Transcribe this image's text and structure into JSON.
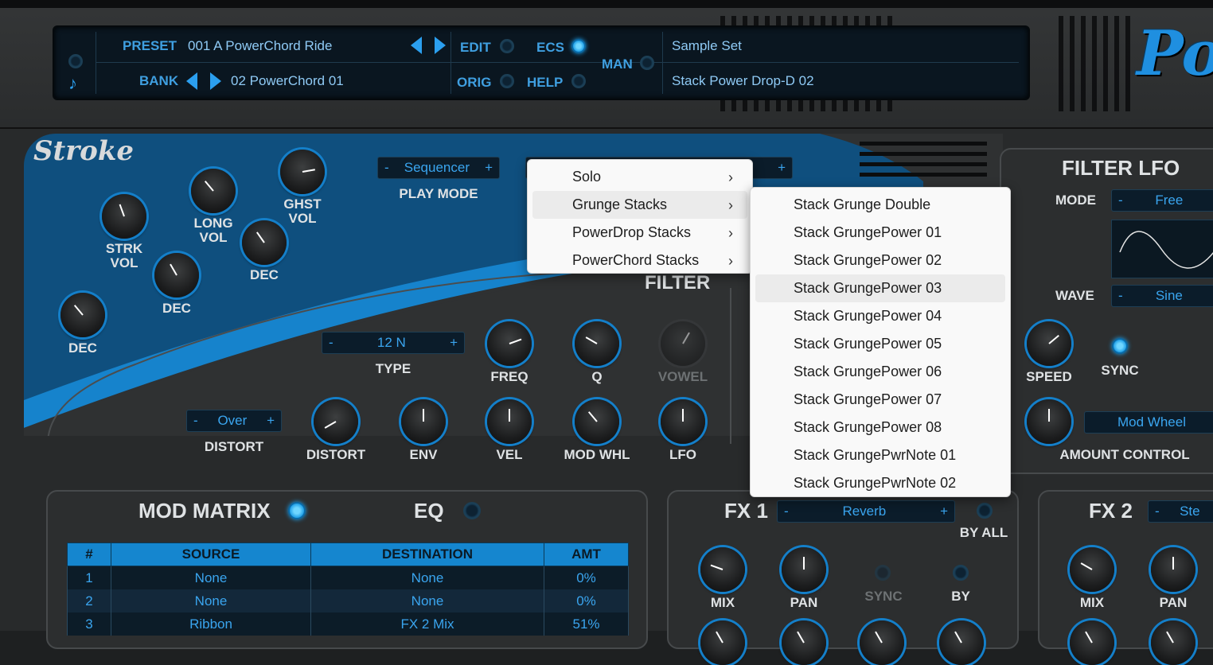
{
  "header": {
    "preset_label": "PRESET",
    "preset_value": "001 A PowerChord Ride",
    "bank_label": "BANK",
    "bank_value": "02 PowerChord 01",
    "edit_label": "EDIT",
    "ecs_label": "ECS",
    "orig_label": "ORIG",
    "help_label": "HELP",
    "man_label": "MAN",
    "sample_set_label": "Sample Set",
    "sample_set_value": "Stack Power Drop-D 02",
    "logo_text": "Po"
  },
  "stroke": {
    "logo": "Stroke",
    "play_mode": {
      "value": "Sequencer",
      "label": "PLAY MODE"
    },
    "knobs": {
      "strk_vol": "STRK\nVOL",
      "long_vol": "LONG\nVOL",
      "ghst_vol": "GHST\nVOL",
      "dec1": "DEC",
      "dec2": "DEC",
      "dec3": "DEC"
    }
  },
  "filter": {
    "title": "FILTER",
    "type": {
      "value": "12 N",
      "label": "TYPE"
    },
    "distort": {
      "value": "Over",
      "label": "DISTORT"
    },
    "knob_labels": {
      "freq": "FREQ",
      "q": "Q",
      "vowel": "VOWEL",
      "distort": "DISTORT",
      "env": "ENV",
      "vel": "VEL",
      "mod_whl": "MOD WHL",
      "lfo": "LFO"
    }
  },
  "filter_lfo": {
    "title": "FILTER LFO",
    "mode_label": "MODE",
    "mode_value": "Free",
    "wave_label": "WAVE",
    "wave_value": "Sine",
    "speed_label": "SPEED",
    "sync_label": "SYNC",
    "amount_control_label": "AMOUNT CONTROL",
    "amount_control_value": "Mod Wheel"
  },
  "mod_matrix": {
    "title": "MOD MATRIX",
    "eq_label": "EQ",
    "columns": [
      "#",
      "SOURCE",
      "DESTINATION",
      "AMT"
    ],
    "rows": [
      [
        "1",
        "None",
        "None",
        "0%"
      ],
      [
        "2",
        "None",
        "None",
        "0%"
      ],
      [
        "3",
        "Ribbon",
        "FX 2 Mix",
        "51%"
      ]
    ]
  },
  "fx1": {
    "title": "FX 1",
    "value": "Reverb",
    "by_all_label": "BY ALL",
    "mix_label": "MIX",
    "pan_label": "PAN",
    "sync_label": "SYNC",
    "by_label": "BY"
  },
  "fx2": {
    "title": "FX 2",
    "value": "Ste",
    "mix_label": "MIX",
    "pan_label": "PAN"
  },
  "menu_main": {
    "items": [
      "Solo",
      "Grunge Stacks",
      "PowerDrop Stacks",
      "PowerChord Stacks"
    ],
    "highlighted_index": 1
  },
  "menu_sub": {
    "items": [
      "Stack Grunge Double",
      "Stack GrungePower 01",
      "Stack GrungePower 02",
      "Stack GrungePower 03",
      "Stack GrungePower 04",
      "Stack GrungePower 05",
      "Stack GrungePower 06",
      "Stack GrungePower 07",
      "Stack GrungePower 08",
      "Stack GrungePwrNote 01",
      "Stack GrungePwrNote 02"
    ],
    "highlighted_index": 3
  },
  "colors": {
    "accent": "#1e9ee6",
    "lcd_text": "#3f9fe0",
    "panel": "#2c2e2f"
  }
}
